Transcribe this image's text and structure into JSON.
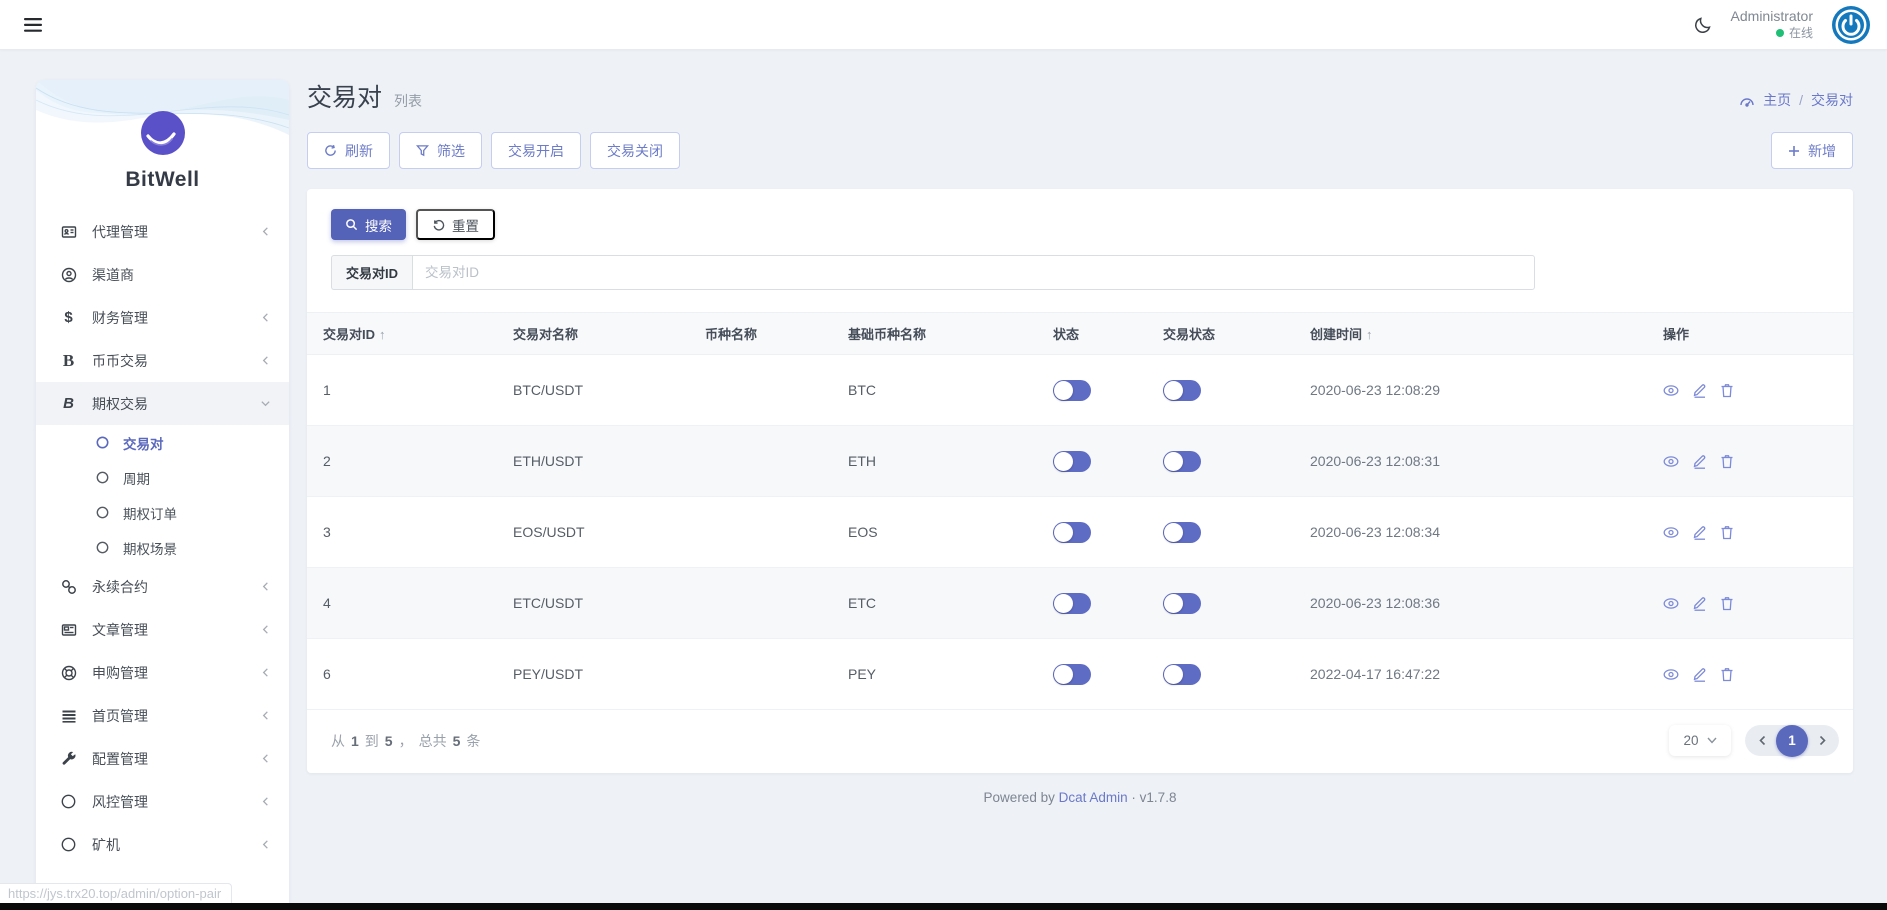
{
  "topbar": {
    "user_name": "Administrator",
    "status_label": "在线"
  },
  "brand": {
    "name": "BitWell"
  },
  "sidebar": {
    "agent": "代理管理",
    "channel": "渠道商",
    "finance": "财务管理",
    "spot": "币币交易",
    "option": "期权交易",
    "sub_pair": "交易对",
    "sub_cycle": "周期",
    "sub_order": "期权订单",
    "sub_scene": "期权场景",
    "perpetual": "永续合约",
    "article": "文章管理",
    "subscribe": "申购管理",
    "home": "首页管理",
    "config": "配置管理",
    "risk": "风控管理",
    "miner": "矿机"
  },
  "icons": {
    "dollar": "$",
    "coin_b": "B",
    "bitcoin_b": "B"
  },
  "header": {
    "title": "交易对",
    "subtitle": "列表",
    "breadcrumb_home": "主页",
    "breadcrumb_sep": "/",
    "breadcrumb_current": "交易对"
  },
  "toolbar": {
    "refresh": "刷新",
    "filter": "筛选",
    "trade_open": "交易开启",
    "trade_close": "交易关闭",
    "add": "新增"
  },
  "search": {
    "search_btn": "搜索",
    "reset_btn": "重置",
    "field_label": "交易对ID",
    "placeholder": "交易对ID"
  },
  "table": {
    "columns": [
      "交易对ID",
      "交易对名称",
      "币种名称",
      "基础币种名称",
      "状态",
      "交易状态",
      "创建时间",
      "操作"
    ],
    "sort_arrow": "↑",
    "rows": [
      {
        "id": "1",
        "name": "BTC/USDT",
        "coin": "",
        "base": "BTC",
        "created": "2020-06-23 12:08:29"
      },
      {
        "id": "2",
        "name": "ETH/USDT",
        "coin": "",
        "base": "ETH",
        "created": "2020-06-23 12:08:31"
      },
      {
        "id": "3",
        "name": "EOS/USDT",
        "coin": "",
        "base": "EOS",
        "created": "2020-06-23 12:08:34"
      },
      {
        "id": "4",
        "name": "ETC/USDT",
        "coin": "",
        "base": "ETC",
        "created": "2020-06-23 12:08:36"
      },
      {
        "id": "6",
        "name": "PEY/USDT",
        "coin": "",
        "base": "PEY",
        "created": "2022-04-17 16:47:22"
      }
    ]
  },
  "pagination": {
    "prefix": "从",
    "from": "1",
    "to_label": "到",
    "to": "5",
    "comma": "，",
    "total_label": "总共",
    "total": "5",
    "unit": "条",
    "page_size": "20",
    "current": "1"
  },
  "footer": {
    "powered": "Powered by",
    "link": "Dcat Admin",
    "dot": "·",
    "version": "v1.7.8"
  },
  "statusbar": {
    "url": "https://jys.trx20.top/admin/option-pair"
  },
  "colors": {
    "accent": "#5b69bd",
    "avatar_blue": "#1478bd",
    "online_green": "#1fbf75"
  }
}
